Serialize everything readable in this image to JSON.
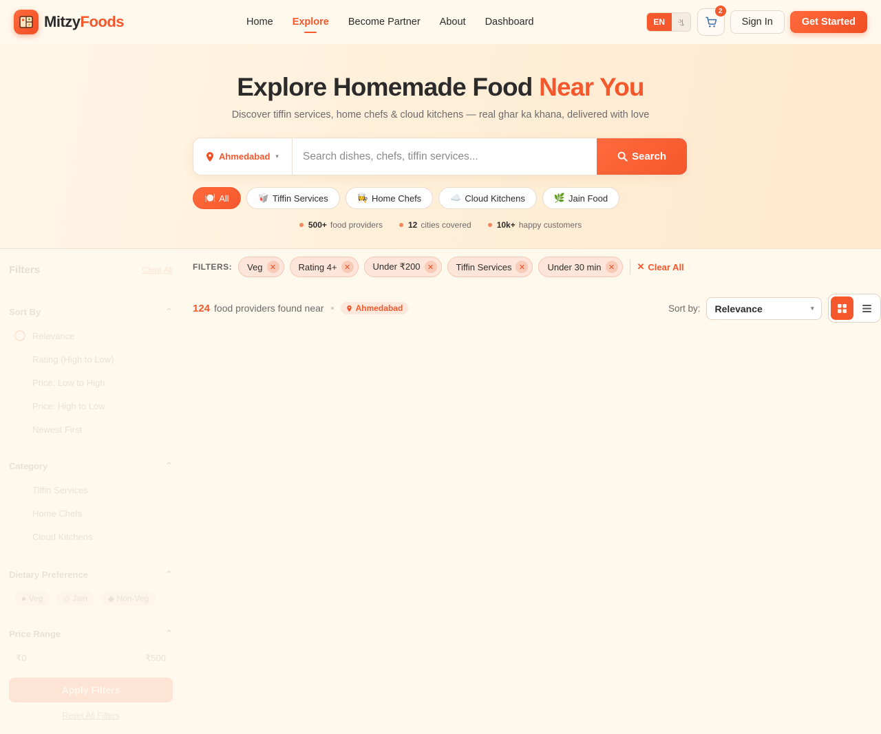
{
  "brand": {
    "name_part1": "Mitzy",
    "name_part2": "Foods"
  },
  "nav": {
    "links": [
      "Home",
      "Explore",
      "Become Partner",
      "About",
      "Dashboard"
    ],
    "active": "Explore",
    "lang_en": "EN",
    "lang_alt": "ગુ",
    "cart_count": "2",
    "signin": "Sign In",
    "get_started": "Get Started"
  },
  "hero": {
    "title_main": "Explore Homemade Food ",
    "title_accent": "Near You",
    "subtitle": "Discover tiffin services, home chefs & cloud kitchens — real ghar ka khana, delivered with love",
    "location": "Ahmedabad",
    "search_placeholder": "Search dishes, chefs, tiffin services...",
    "search_button": "Search",
    "chips": [
      {
        "icon": "🍽️",
        "label": "All"
      },
      {
        "icon": "🥡",
        "label": "Tiffin Services"
      },
      {
        "icon": "👩‍🍳",
        "label": "Home Chefs"
      },
      {
        "icon": "☁️",
        "label": "Cloud Kitchens"
      },
      {
        "icon": "🌿",
        "label": "Jain Food"
      }
    ],
    "stats": [
      {
        "value": "500+",
        "label": "food providers"
      },
      {
        "value": "12",
        "label": "cities covered"
      },
      {
        "value": "10k+",
        "label": "happy customers"
      }
    ]
  },
  "sidebar": {
    "title": "Filters",
    "clear_all": "Clear All",
    "sort_title": "Sort By",
    "sort_options": [
      "Relevance",
      "Rating (High to Low)",
      "Price: Low to High",
      "Price: High to Low",
      "Newest First"
    ],
    "category_title": "Category",
    "category_options": [
      "Tiffin Services",
      "Home Chefs",
      "Cloud Kitchens"
    ],
    "diet_title": "Dietary Preference",
    "diet_options": [
      "● Veg",
      "◇ Jain",
      "◆ Non-Veg"
    ],
    "price_title": "Price Range",
    "price_min": "₹0",
    "price_max": "₹500",
    "apply": "Apply Filters",
    "reset": "Reset All Filters"
  },
  "filters": {
    "label": "FILTERS:",
    "tags": [
      "Veg",
      "Rating 4+",
      "Under ₹200",
      "Tiffin Services",
      "Under 30 min"
    ],
    "clear_all": "Clear All"
  },
  "results": {
    "count": "124",
    "text": "food providers found near",
    "location": "Ahmedabad",
    "sort_label": "Sort by:",
    "sort_value": "Relevance"
  },
  "colors": {
    "accent": "#f4582c",
    "bg": "#fff8ec"
  }
}
